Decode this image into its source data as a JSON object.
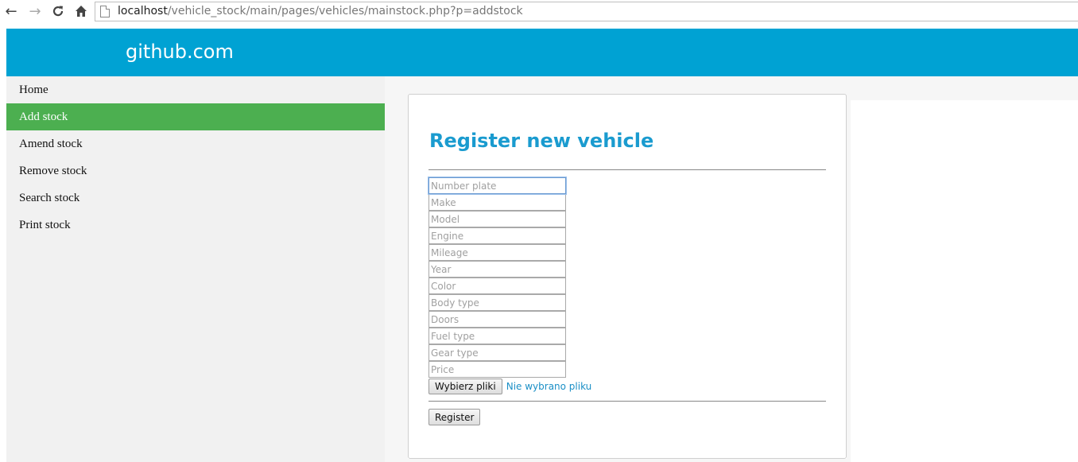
{
  "browser": {
    "url_host": "localhost",
    "url_path": "/vehicle_stock/main/pages/vehicles/mainstock.php?p=addstock",
    "back_icon": "←",
    "forward_icon": "→",
    "reload_icon": "C",
    "home_icon": "⌂"
  },
  "header": {
    "title": "github.com",
    "color": "#00a2d3"
  },
  "sidebar": {
    "active_color": "#4caf50",
    "items": [
      {
        "label": "Home"
      },
      {
        "label": "Add stock"
      },
      {
        "label": "Amend stock"
      },
      {
        "label": "Remove stock"
      },
      {
        "label": "Search stock"
      },
      {
        "label": "Print stock"
      }
    ]
  },
  "form": {
    "title": "Register new vehicle",
    "title_color": "#1a9bcf",
    "fields": [
      {
        "placeholder": "Number plate",
        "value": ""
      },
      {
        "placeholder": "Make",
        "value": ""
      },
      {
        "placeholder": "Model",
        "value": ""
      },
      {
        "placeholder": "Engine",
        "value": ""
      },
      {
        "placeholder": "Mileage",
        "value": ""
      },
      {
        "placeholder": "Year",
        "value": ""
      },
      {
        "placeholder": "Color",
        "value": ""
      },
      {
        "placeholder": "Body type",
        "value": ""
      },
      {
        "placeholder": "Doors",
        "value": ""
      },
      {
        "placeholder": "Fuel type",
        "value": ""
      },
      {
        "placeholder": "Gear type",
        "value": ""
      },
      {
        "placeholder": "Price",
        "value": ""
      }
    ],
    "file_button_label": "Wybierz pliki",
    "file_status": "Nie wybrano pliku",
    "submit_label": "Register"
  }
}
